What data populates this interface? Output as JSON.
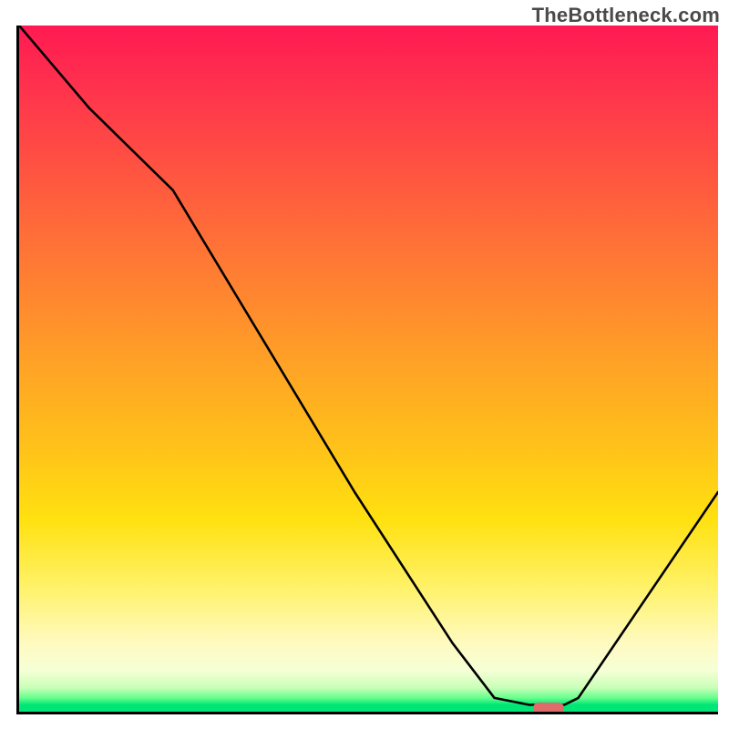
{
  "watermark": "TheBottleneck.com",
  "chart_data": {
    "type": "line",
    "title": "",
    "xlabel": "",
    "ylabel": "",
    "xlim": [
      0,
      100
    ],
    "ylim": [
      0,
      100
    ],
    "grid": false,
    "legend": false,
    "series": [
      {
        "name": "curve",
        "color": "#000000",
        "x": [
          0,
          10,
          22,
          48,
          62,
          68,
          73,
          78,
          80,
          100
        ],
        "y": [
          100,
          88,
          76,
          32,
          10,
          2,
          1,
          1,
          2,
          32
        ]
      }
    ],
    "marker": {
      "x": 75.5,
      "y": 0.5,
      "color": "#e06b6b"
    },
    "background_gradient": {
      "top": "#ff1a52",
      "mid": "#ffe110",
      "bottom": "#00e676"
    }
  }
}
